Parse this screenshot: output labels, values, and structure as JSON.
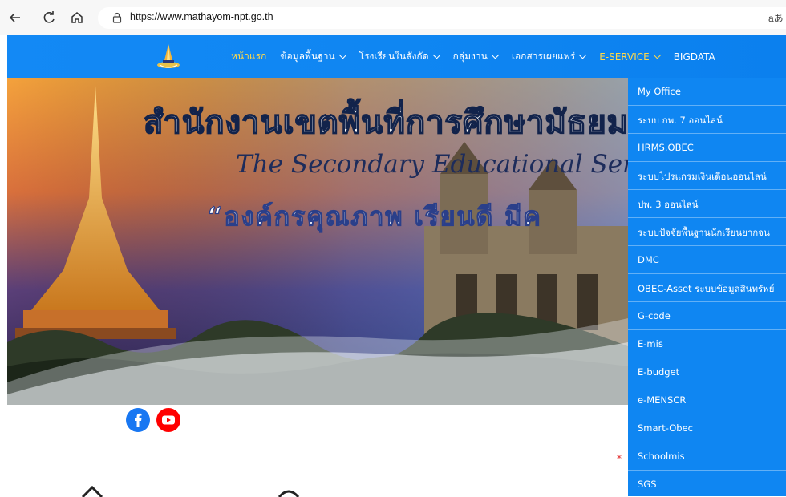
{
  "browser": {
    "url_prefix": "https://",
    "url_domain": "www.mathayom-npt.go.th",
    "read_aloud": "aあ",
    "icons": [
      "back-arrow-icon",
      "reload-icon",
      "home-icon",
      "site-info-icon"
    ]
  },
  "nav": {
    "items": [
      {
        "label": "หน้าแรก",
        "has_dropdown": false
      },
      {
        "label": "ข้อมูลพื้นฐาน",
        "has_dropdown": true
      },
      {
        "label": "โรงเรียนในสังกัด",
        "has_dropdown": true
      },
      {
        "label": "กลุ่มงาน",
        "has_dropdown": true
      },
      {
        "label": "เอกสารเผยแพร่",
        "has_dropdown": true
      },
      {
        "label": "E-SERVICE",
        "has_dropdown": true
      },
      {
        "label": "BIGDATA",
        "has_dropdown": false
      }
    ],
    "active_color": "#ffd84a",
    "bar_color": "#0f86f2"
  },
  "hero": {
    "line1": "สำนักงานเขตพื้นที่การศึกษามัธยมศ",
    "line2": "The Secondary Educational Service Ar",
    "line3": "“องค์กรคุณภาพ เรียนดี มีค"
  },
  "social": {
    "facebook_icon": "facebook-icon",
    "youtube_icon": "youtube-icon"
  },
  "partial_text": "*",
  "eservice_menu": [
    "My Office",
    "ระบบ กพ. 7 ออนไลน์",
    "HRMS.OBEC",
    "ระบบโปรแกรมเงินเดือนออนไลน์",
    "ปพ. 3 ออนไลน์",
    "ระบบปัจจัยพื้นฐานนักเรียนยากจน",
    "DMC",
    "OBEC-Asset ระบบข้อมูลสินทรัพย์",
    "G-code",
    "E-mis",
    "E-budget",
    "e-MENSCR",
    "Smart-Obec",
    "Schoolmis",
    "SGS"
  ]
}
